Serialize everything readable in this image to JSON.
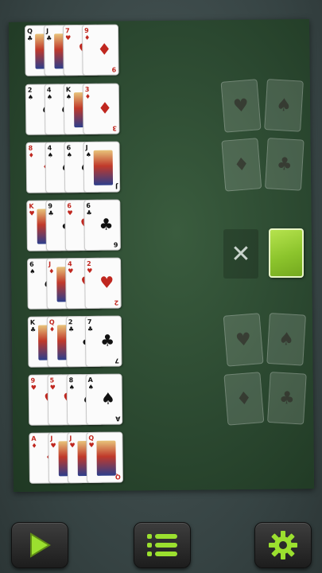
{
  "tableau": [
    [
      {
        "rank": "Q",
        "suit": "♣",
        "color": "black",
        "face": true
      },
      {
        "rank": "J",
        "suit": "♣",
        "color": "black",
        "face": true
      },
      {
        "rank": "7",
        "suit": "♥",
        "color": "red",
        "face": false
      },
      {
        "rank": "9",
        "suit": "♦",
        "color": "red",
        "face": false
      }
    ],
    [
      {
        "rank": "2",
        "suit": "♠",
        "color": "black",
        "face": false
      },
      {
        "rank": "4",
        "suit": "♠",
        "color": "black",
        "face": false
      },
      {
        "rank": "K",
        "suit": "♠",
        "color": "black",
        "face": true
      },
      {
        "rank": "3",
        "suit": "♦",
        "color": "red",
        "face": false
      }
    ],
    [
      {
        "rank": "8",
        "suit": "♦",
        "color": "red",
        "face": false
      },
      {
        "rank": "4",
        "suit": "♠",
        "color": "black",
        "face": false
      },
      {
        "rank": "6",
        "suit": "♠",
        "color": "black",
        "face": false
      },
      {
        "rank": "J",
        "suit": "♠",
        "color": "black",
        "face": true
      }
    ],
    [
      {
        "rank": "K",
        "suit": "♥",
        "color": "red",
        "face": true
      },
      {
        "rank": "9",
        "suit": "♣",
        "color": "black",
        "face": false
      },
      {
        "rank": "6",
        "suit": "♥",
        "color": "red",
        "face": false
      },
      {
        "rank": "6",
        "suit": "♣",
        "color": "black",
        "face": false
      }
    ],
    [
      {
        "rank": "6",
        "suit": "♠",
        "color": "black",
        "face": false
      },
      {
        "rank": "J",
        "suit": "♦",
        "color": "red",
        "face": true
      },
      {
        "rank": "4",
        "suit": "♥",
        "color": "red",
        "face": false
      },
      {
        "rank": "2",
        "suit": "♥",
        "color": "red",
        "face": false
      }
    ],
    [
      {
        "rank": "K",
        "suit": "♣",
        "color": "black",
        "face": true
      },
      {
        "rank": "Q",
        "suit": "♦",
        "color": "red",
        "face": true
      },
      {
        "rank": "2",
        "suit": "♣",
        "color": "black",
        "face": false
      },
      {
        "rank": "7",
        "suit": "♣",
        "color": "black",
        "face": false
      }
    ],
    [
      {
        "rank": "9",
        "suit": "♥",
        "color": "red",
        "face": false
      },
      {
        "rank": "5",
        "suit": "♥",
        "color": "red",
        "face": false
      },
      {
        "rank": "8",
        "suit": "♠",
        "color": "black",
        "face": false
      },
      {
        "rank": "A",
        "suit": "♠",
        "color": "black",
        "face": false
      }
    ],
    [
      {
        "rank": "A",
        "suit": "♦",
        "color": "red",
        "face": false
      },
      {
        "rank": "J",
        "suit": "♥",
        "color": "red",
        "face": true
      },
      {
        "rank": "J",
        "suit": "♥",
        "color": "red",
        "face": true
      },
      {
        "rank": "Q",
        "suit": "♥",
        "color": "red",
        "face": true
      }
    ]
  ],
  "foundations": {
    "top": [
      "♥",
      "♠",
      "♦",
      "♣"
    ],
    "bottom": [
      "♥",
      "♠",
      "♦",
      "♣"
    ]
  },
  "stock": {
    "empty_symbol": "✕",
    "back_color": "#9bd43a"
  },
  "toolbar": {
    "play_icon": "play-icon",
    "menu_icon": "menu-icon",
    "settings_icon": "gear-icon",
    "accent": "#9be02f"
  }
}
